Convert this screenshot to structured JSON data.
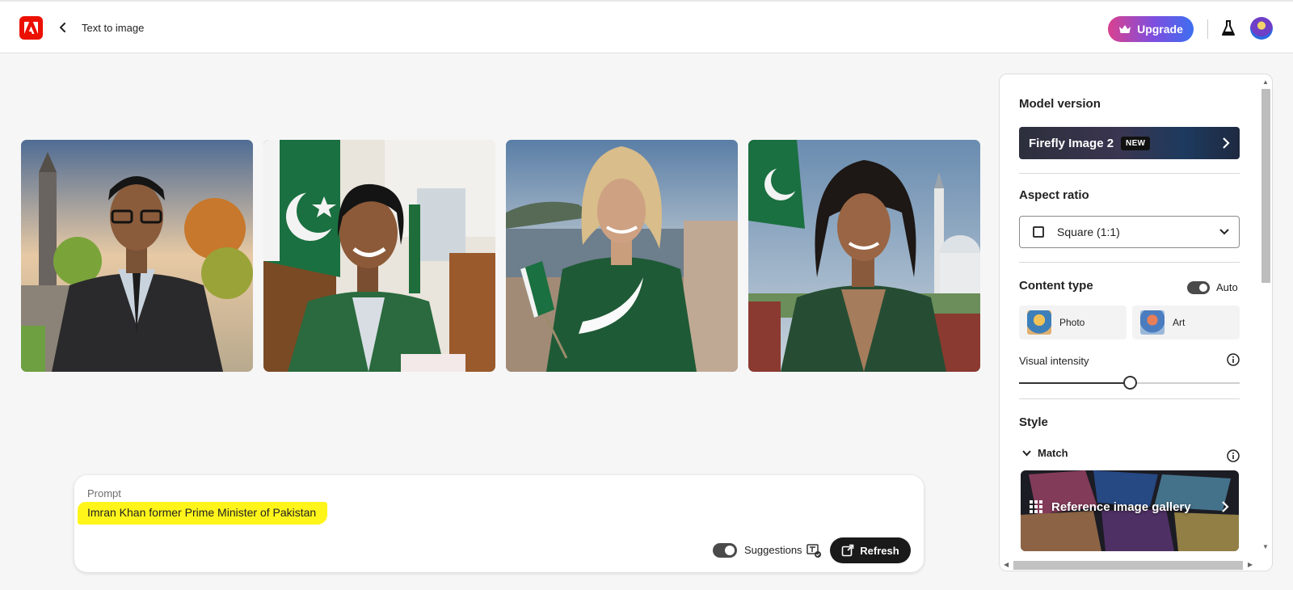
{
  "header": {
    "logo_icon": "adobe-logo-icon",
    "back_icon": "chevron-left-icon",
    "title": "Text to image",
    "upgrade_label": "Upgrade",
    "upgrade_icon": "crown-icon",
    "labs_icon": "flask-icon",
    "avatar_icon": "user-avatar"
  },
  "gallery": {
    "images": [
      {
        "subject": "man-in-suit-glasses"
      },
      {
        "subject": "woman-with-pakistan-flag-office"
      },
      {
        "subject": "blonde-woman-green-blazer-crescent"
      },
      {
        "subject": "woman-green-blazer-mosque"
      }
    ]
  },
  "prompt": {
    "label": "Prompt",
    "text": "Imran Khan former Prime Minister of Pakistan",
    "suggestions_label": "Suggestions",
    "suggestions_on": true,
    "refresh_label": "Refresh"
  },
  "panel": {
    "model_version": {
      "title": "Model version",
      "name": "Firefly Image 2",
      "badge": "NEW"
    },
    "aspect_ratio": {
      "title": "Aspect ratio",
      "value": "Square (1:1)"
    },
    "content_type": {
      "title": "Content type",
      "auto_label": "Auto",
      "auto_on": true,
      "options": [
        {
          "label": "Photo"
        },
        {
          "label": "Art"
        }
      ]
    },
    "visual_intensity": {
      "title": "Visual intensity",
      "value": 0.5
    },
    "style": {
      "title": "Style",
      "match_label": "Match",
      "gallery_label": "Reference image gallery"
    }
  },
  "colors": {
    "accent_red": "#eb1000",
    "highlight": "#fff51a",
    "upgrade_gradient_start": "#d9418f",
    "upgrade_gradient_end": "#3d6ff0"
  }
}
